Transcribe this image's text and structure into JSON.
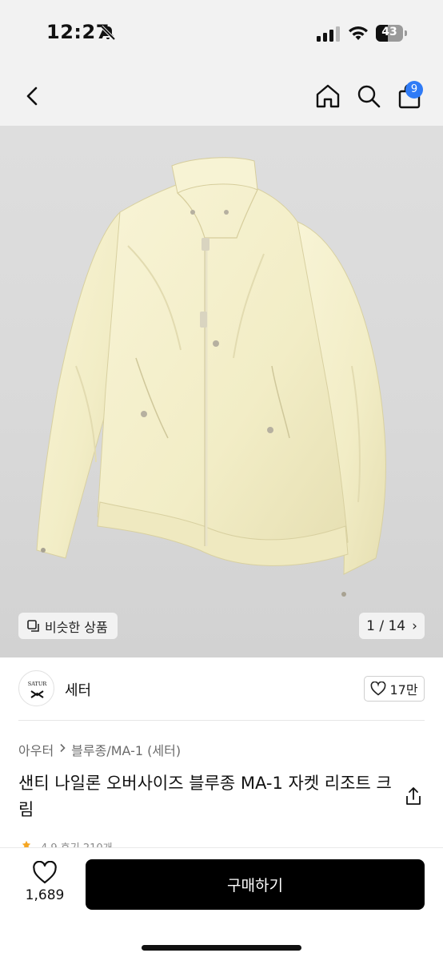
{
  "status_bar": {
    "time": "12:27",
    "battery": "43"
  },
  "header": {
    "cart_count": "9"
  },
  "gallery": {
    "similar_label": "비슷한 상품",
    "page_indicator": "1 / 14",
    "next_arrow": "›"
  },
  "brand": {
    "logo_text_top": "SATUR",
    "name": "세터",
    "likes": "17만"
  },
  "product": {
    "category": "아우터",
    "subcategory": "블루종/MA-1 (세터)",
    "title": "샌티 나일론 오버사이즈 블루종 MA-1 자켓 리조트 크림",
    "rating_peek": "4.9 후기 210개"
  },
  "bottom_bar": {
    "like_count": "1,689",
    "buy_label": "구매하기"
  },
  "colors": {
    "accent_badge": "#2f7bf6",
    "buy_button": "#000000",
    "jacket": "#f4efc8"
  },
  "icons": [
    "back-icon",
    "home-icon",
    "search-icon",
    "shopping-bag-icon",
    "share-icon",
    "heart-icon",
    "similar-items-icon",
    "bell-slash-icon",
    "cellular-signal-icon",
    "wifi-icon",
    "battery-icon"
  ]
}
